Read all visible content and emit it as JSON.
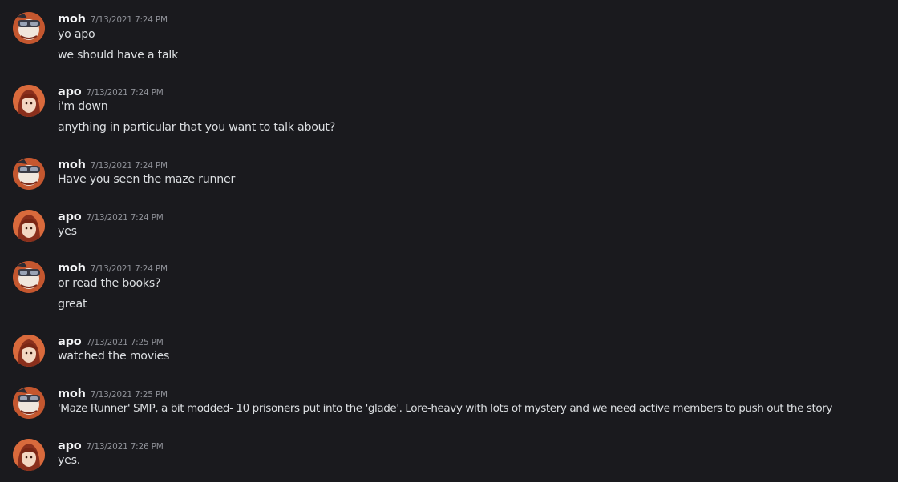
{
  "messages": [
    {
      "author": "moh",
      "timestamp": "7/13/2021 7:24 PM",
      "lines": [
        "yo apo",
        "we should have a talk"
      ]
    },
    {
      "author": "apo",
      "timestamp": "7/13/2021 7:24 PM",
      "lines": [
        "i'm down",
        "anything in particular that you want to talk about?"
      ]
    },
    {
      "author": "moh",
      "timestamp": "7/13/2021 7:24 PM",
      "lines": [
        "Have you seen the maze runner"
      ]
    },
    {
      "author": "apo",
      "timestamp": "7/13/2021 7:24 PM",
      "lines": [
        "yes"
      ]
    },
    {
      "author": "moh",
      "timestamp": "7/13/2021 7:24 PM",
      "lines": [
        "or read the books?",
        "great"
      ]
    },
    {
      "author": "apo",
      "timestamp": "7/13/2021 7:25 PM",
      "lines": [
        "watched the movies"
      ]
    },
    {
      "author": "moh",
      "timestamp": "7/13/2021 7:25 PM",
      "lines": [
        "'Maze Runner' SMP, a bit modded- 10 prisoners put into the 'glade'. Lore-heavy with lots of mystery and we need active members to push out the story"
      ]
    },
    {
      "author": "apo",
      "timestamp": "7/13/2021 7:26 PM",
      "lines": [
        "yes."
      ]
    }
  ],
  "colors": {
    "background": "#1a1a1e",
    "author": "#f2f3f5",
    "timestamp": "#8e9097",
    "message_text": "#dbdee1"
  }
}
